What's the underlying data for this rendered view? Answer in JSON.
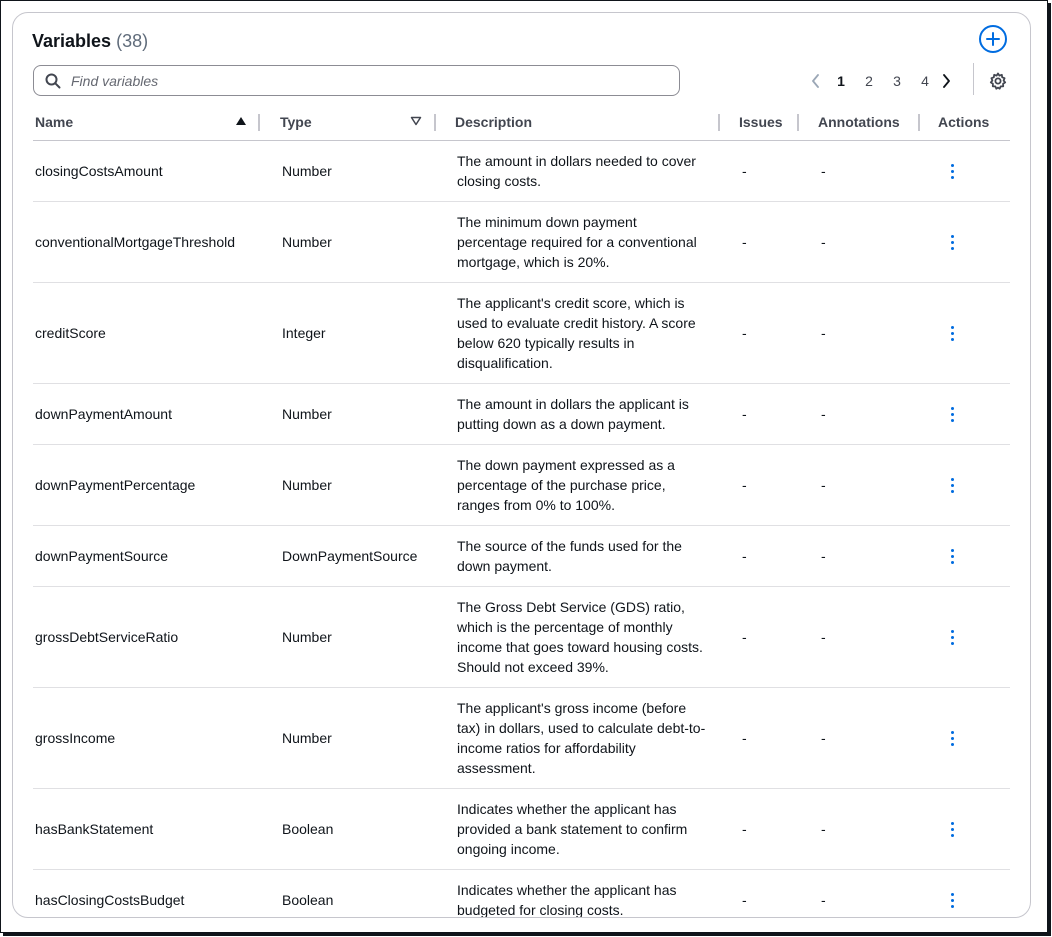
{
  "header": {
    "title": "Variables",
    "count": "(38)"
  },
  "search": {
    "placeholder": "Find variables"
  },
  "pagination": {
    "pages": [
      "1",
      "2",
      "3",
      "4"
    ],
    "current": "1"
  },
  "columns": {
    "name": "Name",
    "type": "Type",
    "description": "Description",
    "issues": "Issues",
    "annotations": "Annotations",
    "actions": "Actions"
  },
  "rows": [
    {
      "name": "closingCostsAmount",
      "type": "Number",
      "description": "The amount in dollars needed to cover closing costs.",
      "issues": "-",
      "annotations": "-"
    },
    {
      "name": "conventionalMortgageThreshold",
      "type": "Number",
      "description": "The minimum down payment percentage required for a conventional mortgage, which is 20%.",
      "issues": "-",
      "annotations": "-"
    },
    {
      "name": "creditScore",
      "type": "Integer",
      "description": "The applicant's credit score, which is used to evaluate credit history. A score below 620 typically results in disqualification.",
      "issues": "-",
      "annotations": "-"
    },
    {
      "name": "downPaymentAmount",
      "type": "Number",
      "description": "The amount in dollars the applicant is putting down as a down payment.",
      "issues": "-",
      "annotations": "-"
    },
    {
      "name": "downPaymentPercentage",
      "type": "Number",
      "description": "The down payment expressed as a percentage of the purchase price, ranges from 0% to 100%.",
      "issues": "-",
      "annotations": "-"
    },
    {
      "name": "downPaymentSource",
      "type": "DownPaymentSource",
      "description": "The source of the funds used for the down payment.",
      "issues": "-",
      "annotations": "-"
    },
    {
      "name": "grossDebtServiceRatio",
      "type": "Number",
      "description": "The Gross Debt Service (GDS) ratio, which is the percentage of monthly income that goes toward housing costs. Should not exceed 39%.",
      "issues": "-",
      "annotations": "-"
    },
    {
      "name": "grossIncome",
      "type": "Number",
      "description": "The applicant's gross income (before tax) in dollars, used to calculate debt-to-income ratios for affordability assessment.",
      "issues": "-",
      "annotations": "-"
    },
    {
      "name": "hasBankStatement",
      "type": "Boolean",
      "description": "Indicates whether the applicant has provided a bank statement to confirm ongoing income.",
      "issues": "-",
      "annotations": "-"
    },
    {
      "name": "hasClosingCostsBudget",
      "type": "Boolean",
      "description": "Indicates whether the applicant has budgeted for closing costs.",
      "issues": "-",
      "annotations": "-"
    }
  ],
  "icons": {
    "add": "add-plus-icon",
    "search": "search-icon",
    "prev": "chevron-left-icon",
    "next": "chevron-right-icon",
    "settings": "gear-icon",
    "sort_asc": "sort-ascending-icon",
    "filter": "sort-descending-icon",
    "row_actions": "kebab-menu-icon"
  },
  "colors": {
    "accent": "#006ce0",
    "text": "#0f141a",
    "muted": "#5f6b7a",
    "border": "#c6c6cd"
  }
}
